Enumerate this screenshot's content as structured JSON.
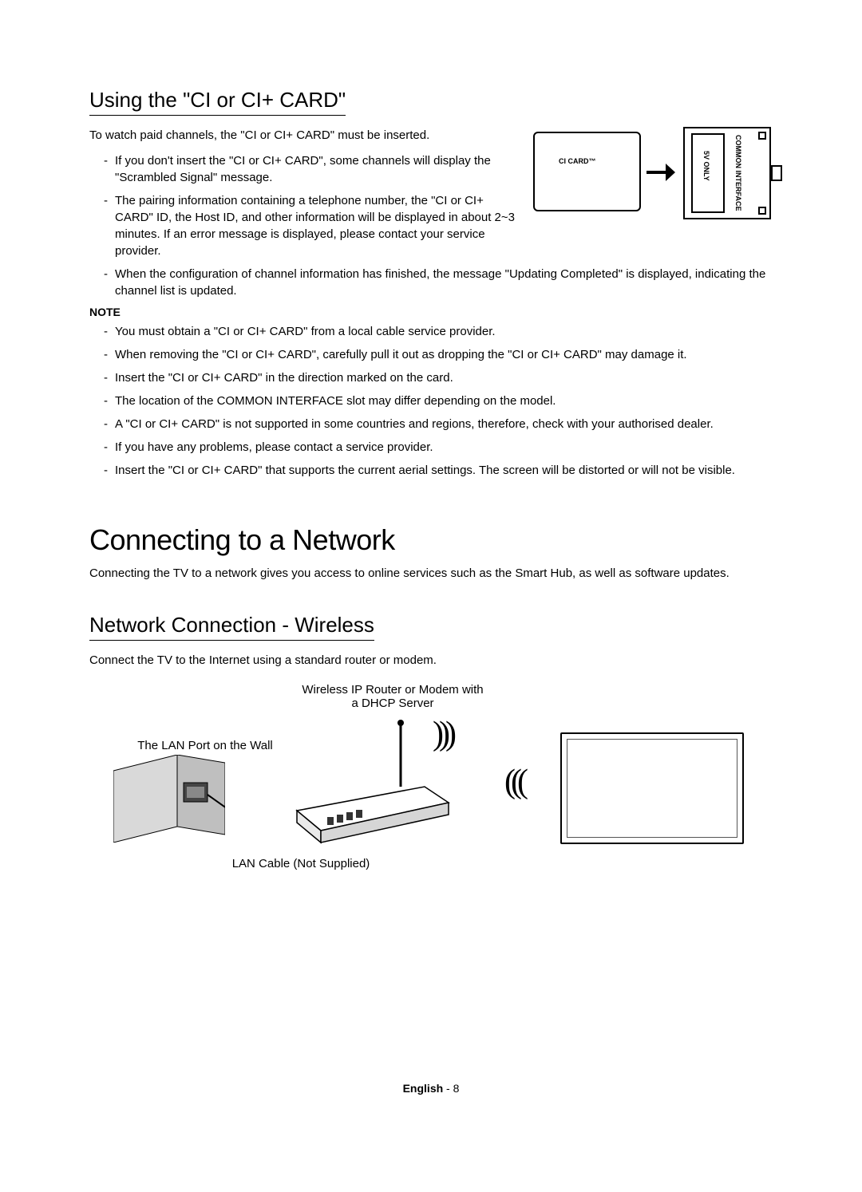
{
  "section1": {
    "heading": "Using the \"CI or CI+ CARD\"",
    "intro": "To watch paid channels, the \"CI or CI+ CARD\" must be inserted.",
    "bullets": [
      "If you don't insert the \"CI or CI+ CARD\", some channels will display the \"Scrambled Signal\" message.",
      "The pairing information containing a telephone number, the \"CI or CI+ CARD\" ID, the Host ID, and other information will be displayed in about 2~3 minutes. If an error message is displayed, please contact your service provider.",
      "When the configuration of channel information has finished, the message \"Updating Completed\" is displayed, indicating the channel list is updated."
    ],
    "note_label": "NOTE",
    "notes": [
      "You must obtain a \"CI or CI+ CARD\" from a local cable service provider.",
      "When removing the \"CI or CI+ CARD\", carefully pull it out as dropping the \"CI or CI+ CARD\" may damage it.",
      "Insert the \"CI or CI+ CARD\" in the direction marked on the card.",
      "The location of the COMMON INTERFACE slot may differ depending on the model.",
      "A \"CI or CI+ CARD\" is not supported in some countries and regions, therefore, check with your authorised dealer.",
      "If you have any problems, please contact a service provider.",
      "Insert the \"CI or CI+ CARD\" that supports the current aerial settings. The screen will be distorted or will not be visible."
    ],
    "fig": {
      "card_label": "CI CARD™",
      "slot_label_1": "5V ONLY",
      "slot_label_2": "COMMON INTERFACE"
    }
  },
  "section2": {
    "heading": "Connecting to a Network",
    "intro": "Connecting the TV to a network gives you access to online services such as the Smart Hub, as well as software updates."
  },
  "section3": {
    "heading": "Network Connection - Wireless",
    "intro": "Connect the TV to the Internet using a standard router or modem.",
    "fig": {
      "router_caption_l1": "Wireless IP Router or Modem with",
      "router_caption_l2": "a DHCP Server",
      "wall_caption": "The LAN Port on the Wall",
      "lan_caption": "LAN Cable (Not Supplied)"
    }
  },
  "footer": {
    "language": "English",
    "sep": " - ",
    "page": "8"
  }
}
